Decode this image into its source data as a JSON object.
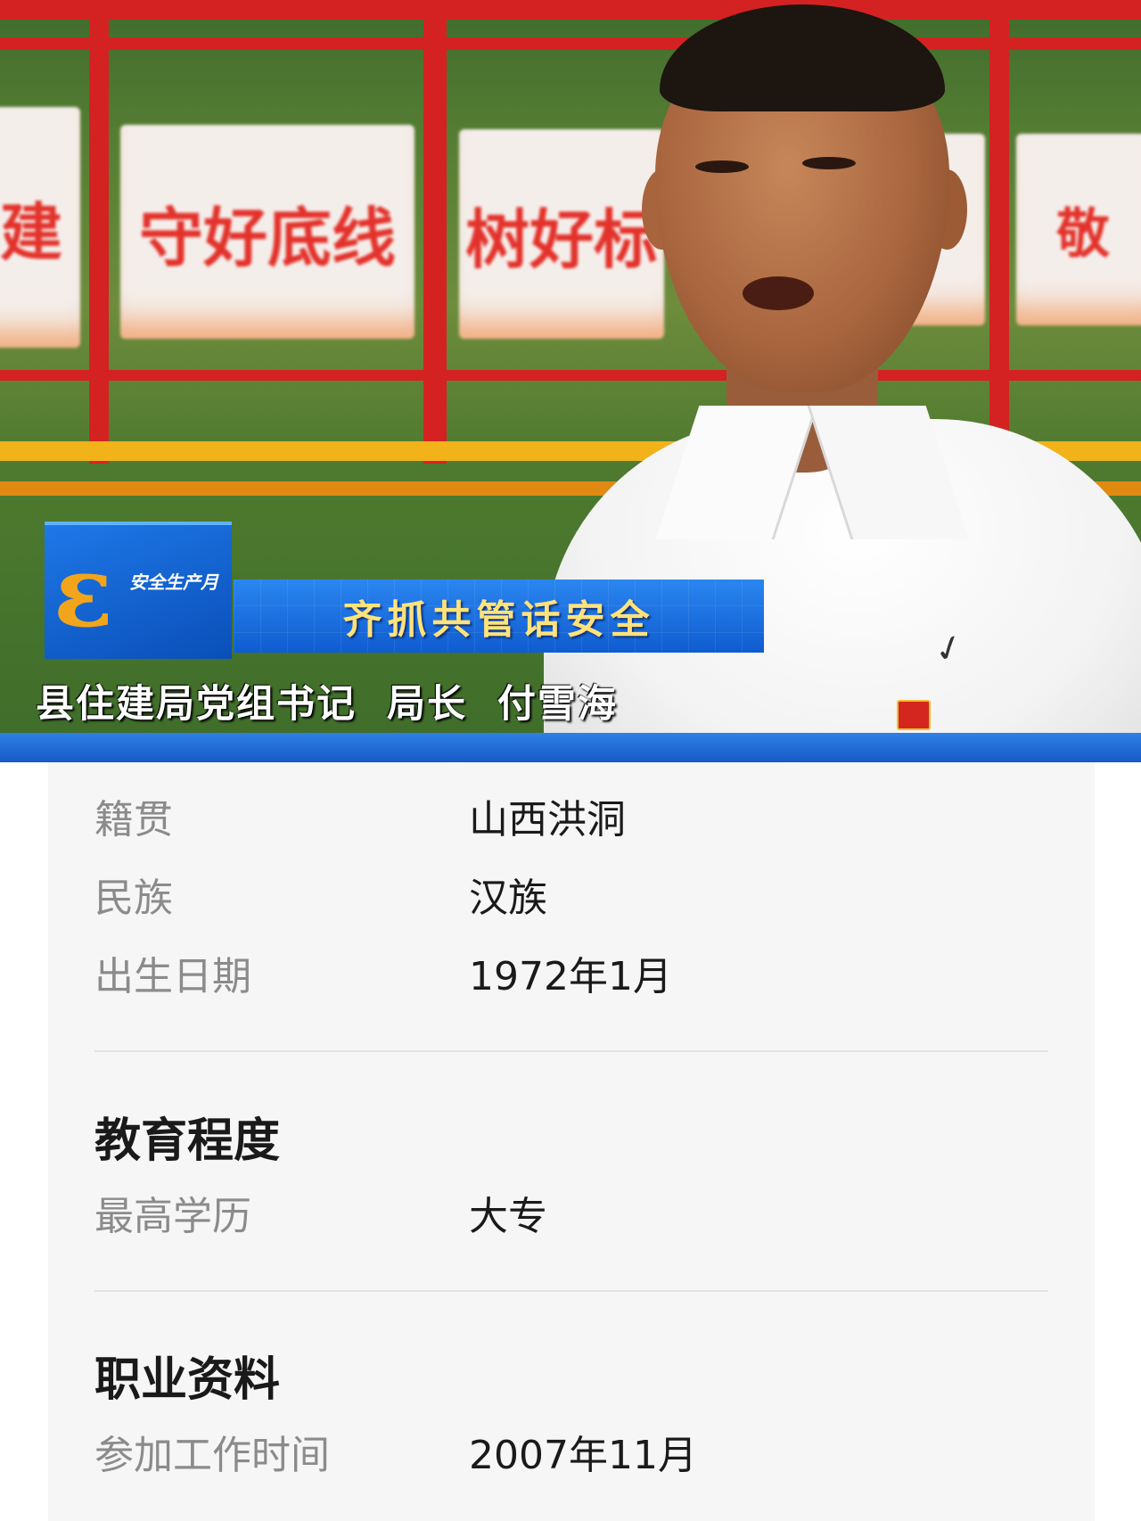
{
  "photo": {
    "banners": [
      "建",
      "守好底线",
      "树好标",
      "",
      "敬"
    ],
    "lower_third": {
      "logo_text": "安全生产月",
      "title": "齐抓共管话安全",
      "caption": "县住建局党组书记  局长  付雪海"
    }
  },
  "profile": {
    "basic_rows": [
      {
        "label": "籍贯",
        "value": "山西洪洞"
      },
      {
        "label": "民族",
        "value": "汉族"
      },
      {
        "label": "出生日期",
        "value": "1972年1月"
      }
    ],
    "education": {
      "title": "教育程度",
      "rows": [
        {
          "label": "最高学历",
          "value": "大专"
        }
      ]
    },
    "career": {
      "title": "职业资料",
      "rows": [
        {
          "label": "参加工作时间",
          "value": "2007年11月"
        }
      ]
    }
  },
  "colors": {
    "rail_red": "#d42222",
    "lower_third_blue": "#1659c6",
    "title_yellow": "#ffe27a",
    "card_bg": "#f6f6f6"
  }
}
